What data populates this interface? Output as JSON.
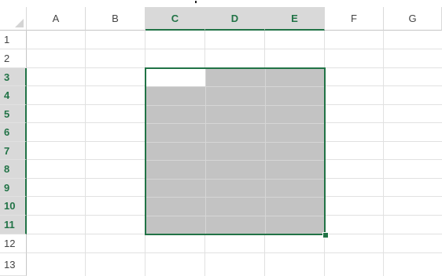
{
  "sheet": {
    "columns": [
      {
        "label": "A",
        "selected": false
      },
      {
        "label": "B",
        "selected": false
      },
      {
        "label": "C",
        "selected": true
      },
      {
        "label": "D",
        "selected": true
      },
      {
        "label": "E",
        "selected": true
      },
      {
        "label": "F",
        "selected": false
      },
      {
        "label": "G",
        "selected": false
      }
    ],
    "rows": [
      {
        "label": "1",
        "selected": false
      },
      {
        "label": "2",
        "selected": false
      },
      {
        "label": "3",
        "selected": true
      },
      {
        "label": "4",
        "selected": true
      },
      {
        "label": "5",
        "selected": true
      },
      {
        "label": "6",
        "selected": true
      },
      {
        "label": "7",
        "selected": true
      },
      {
        "label": "8",
        "selected": true
      },
      {
        "label": "9",
        "selected": true
      },
      {
        "label": "10",
        "selected": true
      },
      {
        "label": "11",
        "selected": true
      },
      {
        "label": "12",
        "selected": false
      },
      {
        "label": "13",
        "selected": false
      }
    ],
    "selected_range": "C3:E11",
    "active_cell": "C3"
  },
  "colors": {
    "accent": "#217346",
    "selection_fill": "#c3c3c3",
    "header_selected_bg": "#d9d9d9",
    "gridline": "#e1e1e1"
  }
}
